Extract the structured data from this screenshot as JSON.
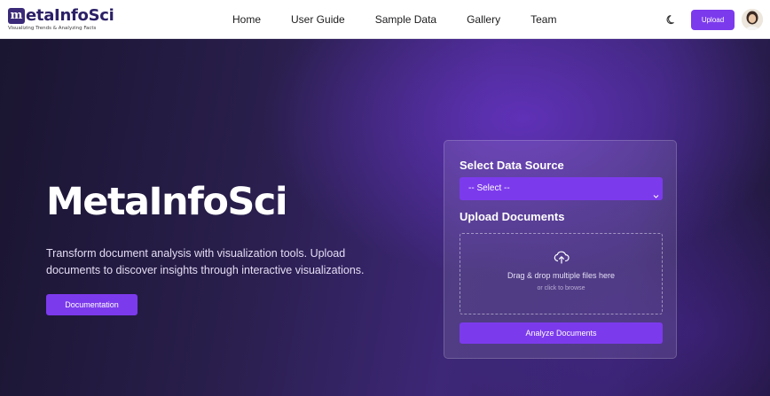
{
  "brand": {
    "mark": "m",
    "name": "etaInfoSci",
    "tagline": "Visualizing Trends & Analyzing Facts"
  },
  "nav": {
    "links": [
      "Home",
      "User Guide",
      "Sample Data",
      "Gallery",
      "Team"
    ],
    "upload_label": "Upload",
    "theme_icon": "moon-icon",
    "avatar_icon": "user-avatar"
  },
  "hero": {
    "title": "MetaInfoSci",
    "description": "Transform document analysis with visualization tools. Upload documents to discover insights through interactive visualizations.",
    "documentation_label": "Documentation"
  },
  "panel": {
    "data_source_heading": "Select Data Source",
    "select_value": "-- Select --",
    "upload_heading": "Upload Documents",
    "drop_text": "Drag & drop multiple files here",
    "drop_subtext": "or click to browse",
    "analyze_label": "Analyze Documents",
    "upload_icon": "cloud-upload-icon"
  },
  "colors": {
    "accent": "#7c3aed",
    "brand_dark": "#2b2066",
    "hero_bg": "#2a1f4e"
  }
}
